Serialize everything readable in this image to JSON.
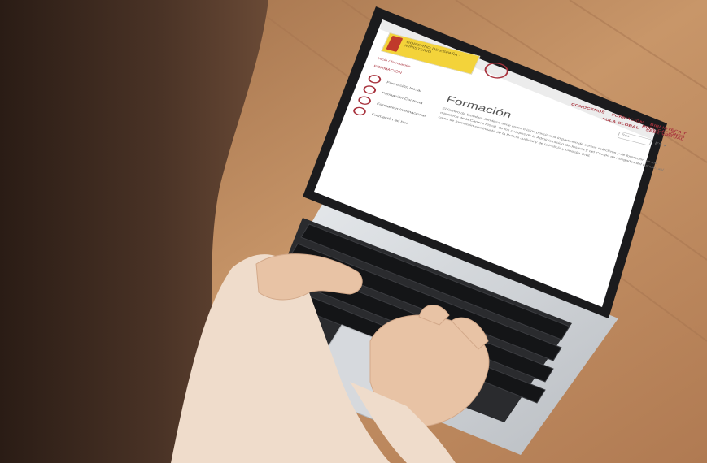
{
  "photo": {
    "subject": "person-typing-on-laptop",
    "colors": {
      "floor": "#c08a5e",
      "hair": "#3a2a20",
      "sweater": "#efdccb",
      "laptop_body": "#cfd2d6",
      "laptop_bezel": "#1b1b1d",
      "keys": "#1e1f22",
      "screen": "#ffffff",
      "accent": "#a8323d"
    }
  },
  "website": {
    "logo_text": "GOBIERNO DE ESPAÑA · MINISTERIO",
    "nav_row_1": [
      "CONÓCENOS",
      "FORMACIÓN",
      "BIBLIOTECA Y PUBLICACIONES"
    ],
    "nav_row_2": [
      "AULA GLOBAL",
      "SEDE VIRTUAL"
    ],
    "search_placeholder": "Bus",
    "search_icon": "search-icon",
    "language_label": "ES ▾",
    "breadcrumb": "Inicio  /  Formación",
    "sidebar_title": "FORMACIÓN",
    "sidebar_items": [
      "Formación Inicial",
      "Formación Continua",
      "Formación Internacional",
      "Formación ad hoc"
    ],
    "page_title": "Formación",
    "intro_text": "El Centro de Estudios Jurídicos tiene como misión principal la impartición de cursos selectivos y de formación de los miembros de la Carrera Fiscal, de los cuerpos de la Administración de Justicia y del Cuerpo de Abogados del Estado, así como de formación continuada de la Policía Judicial y de la Policía y Guardia Civil."
  }
}
